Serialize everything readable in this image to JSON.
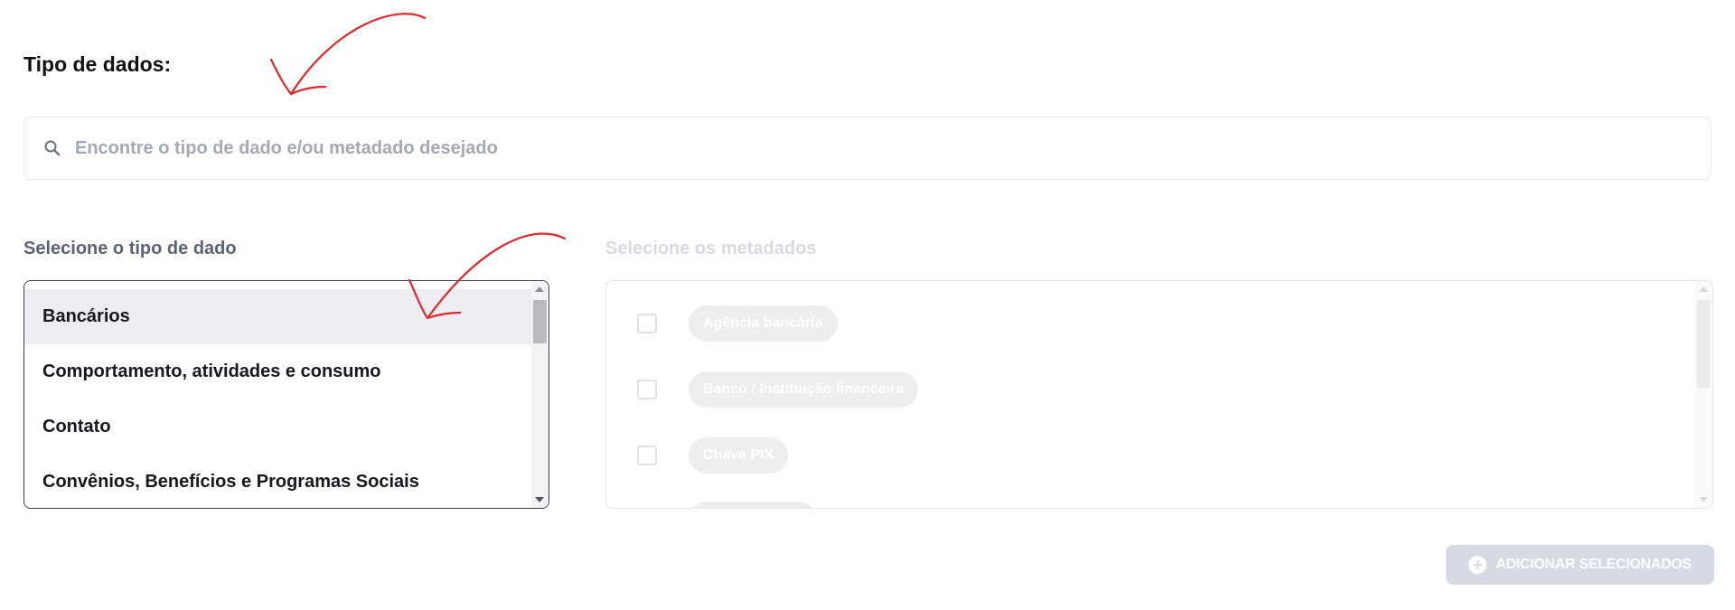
{
  "section": {
    "title": "Tipo de dados:"
  },
  "search": {
    "placeholder": "Encontre o tipo de dado e/ou metadado desejado",
    "value": "",
    "icon": "search-icon"
  },
  "type_column": {
    "label": "Selecione o tipo de dado",
    "selected_index": 0,
    "items": [
      {
        "label": "Bancários"
      },
      {
        "label": "Comportamento, atividades e consumo"
      },
      {
        "label": "Contato"
      },
      {
        "label": "Convênios, Benefícios e Programas Sociais"
      }
    ]
  },
  "metadata_column": {
    "label": "Selecione os metadados",
    "disabled": true,
    "items": [
      {
        "label": "Agência bancária",
        "checked": false
      },
      {
        "label": "Banco / Instituição financeira",
        "checked": false
      },
      {
        "label": "Chave PIX",
        "checked": false
      },
      {
        "label": "",
        "checked": false
      }
    ]
  },
  "actions": {
    "add_selected_label": "ADICIONAR SELECIONADOS",
    "add_icon": "plus-circle-icon",
    "disabled": true
  },
  "colors": {
    "annotation_arrow": "#e0282e",
    "selected_row": "#ededf2",
    "disabled_button": "#d6dae5"
  }
}
